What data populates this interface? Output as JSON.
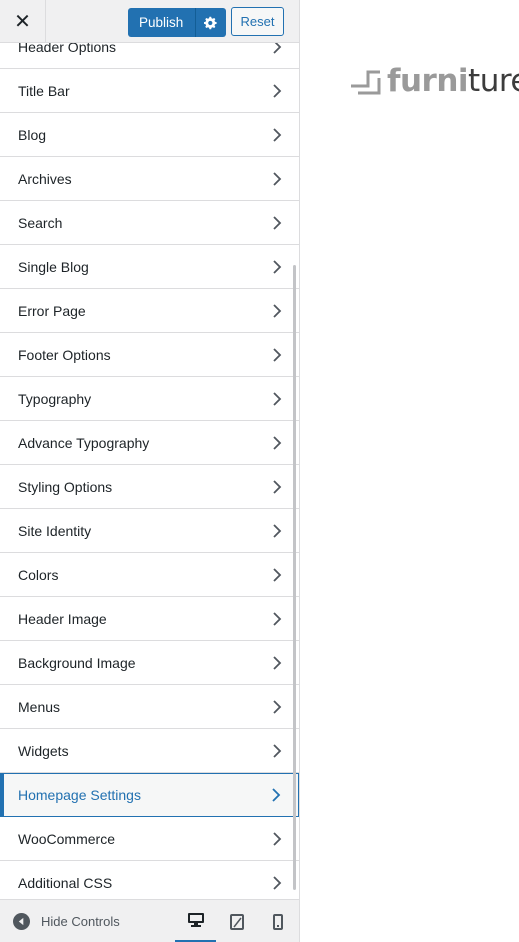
{
  "topbar": {
    "close_glyph": "✕",
    "publish_label": "Publish",
    "reset_label": "Reset"
  },
  "panels": [
    {
      "label": "Header Options",
      "name": "header-options"
    },
    {
      "label": "Title Bar",
      "name": "title-bar"
    },
    {
      "label": "Blog",
      "name": "blog"
    },
    {
      "label": "Archives",
      "name": "archives"
    },
    {
      "label": "Search",
      "name": "search"
    },
    {
      "label": "Single Blog",
      "name": "single-blog"
    },
    {
      "label": "Error Page",
      "name": "error-page"
    },
    {
      "label": "Footer Options",
      "name": "footer-options"
    },
    {
      "label": "Typography",
      "name": "typography"
    },
    {
      "label": "Advance Typography",
      "name": "advance-typography"
    },
    {
      "label": "Styling Options",
      "name": "styling-options"
    },
    {
      "label": "Site Identity",
      "name": "site-identity"
    },
    {
      "label": "Colors",
      "name": "colors"
    },
    {
      "label": "Header Image",
      "name": "header-image"
    },
    {
      "label": "Background Image",
      "name": "background-image"
    },
    {
      "label": "Menus",
      "name": "menus"
    },
    {
      "label": "Widgets",
      "name": "widgets"
    },
    {
      "label": "Homepage Settings",
      "name": "homepage-settings",
      "active": true
    },
    {
      "label": "WooCommerce",
      "name": "woocommerce"
    },
    {
      "label": "Additional CSS",
      "name": "additional-css"
    }
  ],
  "footer": {
    "hide_controls_label": "Hide Controls",
    "devices": [
      "desktop-icon",
      "tablet-icon",
      "mobile-icon"
    ],
    "active_device": "desktop"
  },
  "preview": {
    "logo_light": "furni",
    "logo_dark": "ture"
  },
  "colors": {
    "accent": "#2271b1",
    "text": "#1d2327",
    "border": "#dcdcde"
  }
}
